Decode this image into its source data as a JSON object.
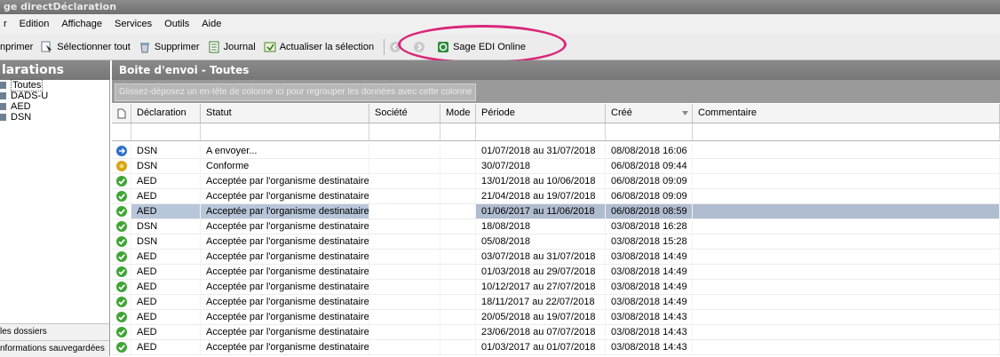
{
  "window": {
    "title": "ge directDéclaration"
  },
  "menu": [
    "r",
    "Edition",
    "Affichage",
    "Services",
    "Outils",
    "Aide"
  ],
  "toolbar": {
    "imprimer": "nprimer",
    "selectionner": "Sélectionner tout",
    "supprimer": "Supprimer",
    "journal": "Journal",
    "actualiser": "Actualiser la sélection",
    "edi": "Sage EDI Online"
  },
  "sidebar": {
    "title": "larations",
    "items": [
      "Toutes",
      "DADS-U",
      "AED",
      "DSN"
    ],
    "bottom": [
      "les dossiers",
      "nformations sauvegardées"
    ]
  },
  "main": {
    "title": "Boite d'envoi - Toutes",
    "group_hint": "Glissez-déposez un en-tête de colonne ici pour regrouper les données avec cette colonne"
  },
  "grid": {
    "columns": [
      "Déclaration",
      "Statut",
      "Société",
      "Mode",
      "Période",
      "Créé",
      "Commentaire"
    ],
    "rows": [
      {
        "decl": "DSN",
        "statut": "A envoyer...",
        "periode": "01/07/2018 au 31/07/2018",
        "cree": "08/08/2018 16:06",
        "icon": "pending"
      },
      {
        "decl": "DSN",
        "statut": "Conforme",
        "periode": "30/07/2018",
        "cree": "06/08/2018 09:44",
        "icon": "conform"
      },
      {
        "decl": "AED",
        "statut": "Acceptée par l'organisme destinataire",
        "periode": "13/01/2018 au 10/06/2018",
        "cree": "06/08/2018 09:09",
        "icon": "ok"
      },
      {
        "decl": "AED",
        "statut": "Acceptée par l'organisme destinataire",
        "periode": "21/04/2018 au 19/07/2018",
        "cree": "06/08/2018 09:09",
        "icon": "ok"
      },
      {
        "decl": "AED",
        "statut": "Acceptée par l'organisme destinataire",
        "periode": "01/06/2017 au 11/06/2018",
        "cree": "06/08/2018 08:59",
        "icon": "ok",
        "selected": true
      },
      {
        "decl": "DSN",
        "statut": "Acceptée par l'organisme destinataire",
        "periode": "18/08/2018",
        "cree": "03/08/2018 16:28",
        "icon": "ok"
      },
      {
        "decl": "DSN",
        "statut": "Acceptée par l'organisme destinataire",
        "periode": "05/08/2018",
        "cree": "03/08/2018 15:28",
        "icon": "ok"
      },
      {
        "decl": "AED",
        "statut": "Acceptée par l'organisme destinataire",
        "periode": "03/07/2018 au 31/07/2018",
        "cree": "03/08/2018 14:49",
        "icon": "ok"
      },
      {
        "decl": "AED",
        "statut": "Acceptée par l'organisme destinataire",
        "periode": "01/03/2018 au 29/07/2018",
        "cree": "03/08/2018 14:49",
        "icon": "ok"
      },
      {
        "decl": "AED",
        "statut": "Acceptée par l'organisme destinataire",
        "periode": "10/12/2017 au 27/07/2018",
        "cree": "03/08/2018 14:49",
        "icon": "ok"
      },
      {
        "decl": "AED",
        "statut": "Acceptée par l'organisme destinataire",
        "periode": "18/11/2017 au 22/07/2018",
        "cree": "03/08/2018 14:49",
        "icon": "ok"
      },
      {
        "decl": "AED",
        "statut": "Acceptée par l'organisme destinataire",
        "periode": "20/05/2018 au 19/07/2018",
        "cree": "03/08/2018 14:43",
        "icon": "ok"
      },
      {
        "decl": "AED",
        "statut": "Acceptée par l'organisme destinataire",
        "periode": "23/06/2018 au 07/07/2018",
        "cree": "03/08/2018 14:43",
        "icon": "ok"
      },
      {
        "decl": "AED",
        "statut": "Acceptée par l'organisme destinataire",
        "periode": "01/03/2017 au 01/07/2018",
        "cree": "03/08/2018 14:43",
        "icon": "ok"
      }
    ]
  },
  "colors": {
    "accent": "#d8297a",
    "selected_row": "#b8c6da",
    "ok": "#3fa535",
    "pending": "#2f6fce",
    "conform": "#d9a316"
  }
}
